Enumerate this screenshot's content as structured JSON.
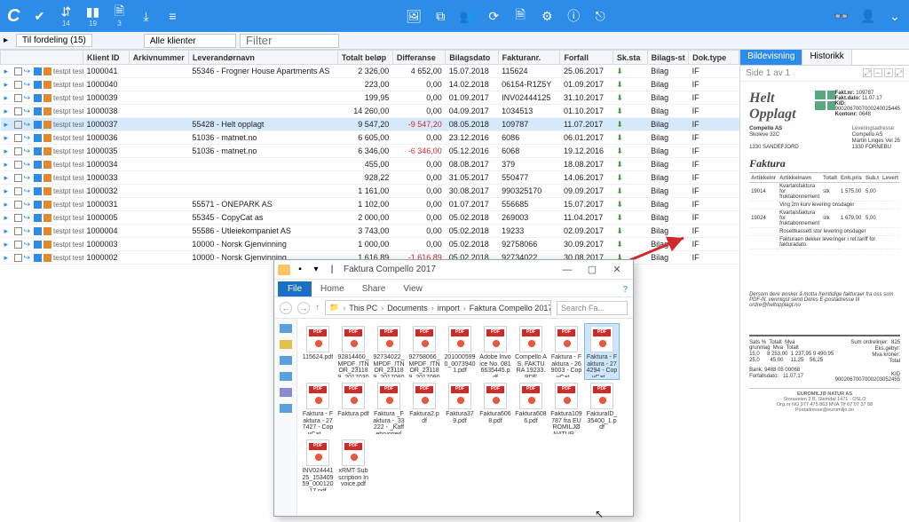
{
  "topbar": {
    "counts": [
      "14",
      "19",
      "3"
    ]
  },
  "filter": {
    "tab": "Til fordeling (15)",
    "klienter": "Alle klienter",
    "filter_placeholder": "Filter"
  },
  "grid": {
    "headers": [
      "",
      "Klient ID",
      "Arkivnummer",
      "Leverandørnavn",
      "Totalt beløp",
      "Differanse",
      "Bilagsdato",
      "Fakturanr.",
      "Forfall",
      "Sk.sta",
      "Bilags-st",
      "Dok.type"
    ],
    "rows": [
      {
        "klient": "testpt testpt",
        "id": "1000041",
        "arkiv": "55346 - Frogner House Apartments AS",
        "belop": "2 326,00",
        "diff": "4 652,00",
        "dato": "15.07.2018",
        "fnr": "115624",
        "forfall": "25.06.2017",
        "bilag": "Bilag",
        "dtype": "IF"
      },
      {
        "klient": "testpt testpt",
        "id": "1000040",
        "arkiv": "",
        "belop": "223,00",
        "diff": "0,00",
        "dato": "14.02.2018",
        "fnr": "06154-R1Z5Y",
        "forfall": "01.09.2017",
        "bilag": "Bilag",
        "dtype": "IF"
      },
      {
        "klient": "testpt testpt",
        "id": "1000039",
        "arkiv": "",
        "belop": "199,95",
        "diff": "0,00",
        "dato": "01.09.2017",
        "fnr": "INV02444125",
        "forfall": "31.10.2017",
        "bilag": "Bilag",
        "dtype": "IF"
      },
      {
        "klient": "testpt testpt",
        "id": "1000038",
        "arkiv": "",
        "belop": "14 260,00",
        "diff": "0,00",
        "dato": "04.09.2017",
        "fnr": "1034513",
        "forfall": "01.10.2017",
        "bilag": "Bilag",
        "dtype": "IF"
      },
      {
        "sel": true,
        "klient": "testpt testpt",
        "id": "1000037",
        "arkiv": "55428 - Helt opplagt",
        "belop": "9 547,20",
        "diff": "-9 547,20",
        "diffneg": true,
        "dato": "08.05.2018",
        "fnr": "109787",
        "forfall": "11.07.2017",
        "bilag": "Bilag",
        "dtype": "IF"
      },
      {
        "klient": "testpt testpt",
        "id": "1000036",
        "arkiv": "51036 - matnet.no",
        "belop": "6 605,00",
        "diff": "0,00",
        "dato": "23.12.2016",
        "fnr": "6086",
        "forfall": "06.01.2017",
        "bilag": "Bilag",
        "dtype": "IF"
      },
      {
        "klient": "testpt testpt",
        "id": "1000035",
        "arkiv": "51036 - matnet.no",
        "belop": "6 346,00",
        "diff": "-6 346,00",
        "diffneg": true,
        "dato": "05.12.2016",
        "fnr": "6068",
        "forfall": "19.12.2016",
        "bilag": "Bilag",
        "dtype": "IF"
      },
      {
        "klient": "testpt testpt",
        "id": "1000034",
        "arkiv": "",
        "belop": "455,00",
        "diff": "0,00",
        "dato": "08.08.2017",
        "fnr": "379",
        "forfall": "18.08.2017",
        "bilag": "Bilag",
        "dtype": "IF"
      },
      {
        "klient": "testpt testpt",
        "id": "1000033",
        "arkiv": "",
        "belop": "928,22",
        "diff": "0,00",
        "dato": "31.05.2017",
        "fnr": "550477",
        "forfall": "14.06.2017",
        "bilag": "Bilag",
        "dtype": "IF"
      },
      {
        "klient": "testpt testpt",
        "id": "1000032",
        "arkiv": "",
        "belop": "1 161,00",
        "diff": "0,00",
        "dato": "30.08.2017",
        "fnr": "990325170",
        "forfall": "09.09.2017",
        "bilag": "Bilag",
        "dtype": "IF"
      },
      {
        "klient": "testpt testpt",
        "id": "1000031",
        "arkiv": "55571 - ONEPARK AS",
        "belop": "1 102,00",
        "diff": "0,00",
        "dato": "01.07.2017",
        "fnr": "556685",
        "forfall": "15.07.2017",
        "bilag": "Bilag",
        "dtype": "IF"
      },
      {
        "klient": "testpt testpt",
        "id": "1000005",
        "arkiv": "55345 - CopyCat as",
        "belop": "2 000,00",
        "diff": "0,00",
        "dato": "05.02.2018",
        "fnr": "269003",
        "forfall": "11.04.2017",
        "bilag": "Bilag",
        "dtype": "IF"
      },
      {
        "klient": "testpt testpt",
        "id": "1000004",
        "arkiv": "55586 - Utleiekompaniet AS",
        "belop": "3 743,00",
        "diff": "0,00",
        "dato": "05.02.2018",
        "fnr": "19233",
        "forfall": "02.09.2017",
        "bilag": "Bilag",
        "dtype": "IF"
      },
      {
        "klient": "testpt testpt",
        "id": "1000003",
        "arkiv": "10000 - Norsk Gjenvinning",
        "belop": "1 000,00",
        "diff": "0,00",
        "dato": "05.02.2018",
        "fnr": "92758066",
        "forfall": "30.09.2017",
        "bilag": "Bilag",
        "dtype": "IF"
      },
      {
        "klient": "testpt testpt",
        "id": "1000002",
        "arkiv": "10000 - Norsk Gjenvinning",
        "belop": "1 616,89",
        "diff": "-1 616,89",
        "diffneg": true,
        "dato": "05.02.2018",
        "fnr": "92734022",
        "forfall": "30.08.2017",
        "bilag": "Bilag",
        "dtype": "IF"
      }
    ]
  },
  "preview": {
    "tab1": "Bildevisning",
    "tab2": "Historikk",
    "page": "Side 1 av 1",
    "doc": {
      "brand": "Helt Opplagt",
      "company": "Compello AS",
      "street": "Skoleve 32C",
      "city": "1330   SANDEFJORD",
      "lev_label": "Leveringsadresse:",
      "lev1": "Compello AS",
      "lev2": "Martin Linges Vei 25",
      "lev3": "1330   FORNEBU",
      "fact_label": "Fakt.nr:",
      "fact_val": "109787",
      "date_label": "Fakt.dato:",
      "date_val": "11.07.17",
      "kid_label": "KID:",
      "kid_val": "9002067007000240025445",
      "konto_label": "Kontonr:",
      "konto_val": "0648",
      "section": "Faktura",
      "th1": "Artikkelnr",
      "th2": "Artikkelnavn",
      "th3": "Totalt",
      "th4": "Enh.pris",
      "th5": "Sub.t",
      "th6": "Levert",
      "r1c1": "19014",
      "r1c2": "Kvartalsfaktura for fruktabonnement",
      "r1c3": "stk",
      "r1c4": "1 575,00",
      "r1c5": "5,00",
      "r1c6": "",
      "r2": "Ving 2m kurv levering onsdager",
      "r3c1": "19024",
      "r3c2": "Kvartalsfaktura for fruktabonnement",
      "r3c3": "stk",
      "r3c4": "1 679,00",
      "r3c5": "5,00",
      "r3c6": "",
      "r4": "Rosettkassett stor levering onsdager",
      "r5": "Fakturaen dekker leveringer i ref.tariff for fakturadato.",
      "note": "Dersom dere ønsker å motta fremtidige fakturaer fra oss som PDF-fil, vennligst send Deres E-postadresse til ordre@heltopplagt.no",
      "tot_sats": "Sats %",
      "tot_total": "Totalt",
      "tot_mvagrl": "Mva grunnlag",
      "tot_mva": "Mva",
      "tot_totalt": "Totalt",
      "tot_r1": "15,0",
      "tot_r2": "8 253,00",
      "tot_r3": "1 237,95",
      "tot_r4": "9 490,95",
      "tot_r5": "25,0",
      "tot_r6": "45,00",
      "tot_r7": "11,25",
      "tot_r8": "56,25",
      "sum_lbl": "Sum ordrelinjer:",
      "sum_val": "825",
      "eks_lbl": "Eks.gebyr:",
      "mva_lbl": "Mva kroner:",
      "total_lbl": "Total",
      "bank": "Bank: 9488 05 00068",
      "forfall_lbl": "Forfallsdato:",
      "forfall_val": "11.07.17",
      "kid2": "KID   9002067007000203052455",
      "footer1": "EUROMILJØ NATUR AS",
      "footer2": "Storaveien 2 B, Slemdal   1471 - OSLO",
      "footer3": "Org.nr NO 977 475 863   MVA   Tlf 67 07 37 88   Postadresse@euromiljo.no"
    }
  },
  "explorer": {
    "title": "Faktura Compello 2017",
    "tabs": {
      "file": "File",
      "home": "Home",
      "share": "Share",
      "view": "View"
    },
    "bc": [
      "This PC",
      "Documents",
      "import",
      "Faktura Compello 2017"
    ],
    "search": "Search Fa...",
    "files": [
      {
        "n": "115624.pdf"
      },
      {
        "n": "92814460_MPDF_ITNOR_231189_20170301..."
      },
      {
        "n": "92734022_MPDF_ITNOR_231189_20170801..."
      },
      {
        "n": "92758066_MPDF_ITNOR_231189_20170901..."
      },
      {
        "n": "2010005990_00739401.pdf"
      },
      {
        "n": "Adobe Invoice No. 0816635445.pdf"
      },
      {
        "n": "Compello AS, FAKTURA 19233.PDF"
      },
      {
        "n": "Faktura - Faktura - 269003 - CopyCat ..."
      },
      {
        "n": "Faktura - Faktura - 274294 - CopyCat ...",
        "sel": true
      },
      {
        "n": "Faktura - Faktura - 277427 - CopyCat ..."
      },
      {
        "n": "Faktura.pdf"
      },
      {
        "n": "Faktura _Faktura -_33222 - _Kaffebryggerle..."
      },
      {
        "n": "Faktura2.pdf"
      },
      {
        "n": "Faktura379.pdf"
      },
      {
        "n": "Faktura6068.pdf"
      },
      {
        "n": "Faktura6086.pdf"
      },
      {
        "n": "Faktura109787 fra EUROMILJØ NATUR..."
      },
      {
        "n": "FakturaID_35400_1.pdf"
      },
      {
        "n": "INV02444125_15340959_00012017.pdf"
      },
      {
        "n": "xRMT Subscription Invoice.pdf"
      }
    ]
  }
}
